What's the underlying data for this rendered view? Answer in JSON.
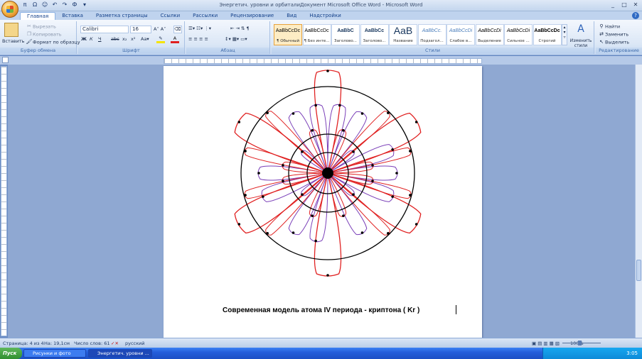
{
  "window": {
    "title": "Энергетич. уровни и орбиталиДокумент Microsoft Office Word - Microsoft Word",
    "qat": [
      "π",
      "Ω",
      "☺",
      "↶",
      "↷",
      "Ф",
      "▾"
    ]
  },
  "tabs": [
    "Главная",
    "Вставка",
    "Разметка страницы",
    "Ссылки",
    "Рассылки",
    "Рецензирование",
    "Вид",
    "Надстройки"
  ],
  "clipboard": {
    "paste": "Вставить",
    "cut": "Вырезать",
    "copy": "Копировать",
    "format": "Формат по образцу",
    "label": "Буфер обмена"
  },
  "font": {
    "name": "Calibri (Основной те",
    "size": "16",
    "label": "Шрифт"
  },
  "paragraph": {
    "label": "Абзац"
  },
  "styles": {
    "label": "Стили",
    "items": [
      {
        "sample": "AaBbCcDc",
        "name": "¶ Обычный"
      },
      {
        "sample": "AaBbCcDc",
        "name": "¶ Без инте..."
      },
      {
        "sample": "AaBbC",
        "name": "Заголово..."
      },
      {
        "sample": "AaBbCc",
        "name": "Заголово..."
      },
      {
        "sample": "AaB",
        "name": "Название"
      },
      {
        "sample": "AaBbCc.",
        "name": "Подзагол..."
      },
      {
        "sample": "AaBbCcDi",
        "name": "Слабое в..."
      },
      {
        "sample": "AaBbCcDi",
        "name": "Выделение"
      },
      {
        "sample": "AaBbCcDi",
        "name": "Сильное ..."
      },
      {
        "sample": "AaBbCcDc",
        "name": "Строгий"
      }
    ],
    "change": "Изменить стили"
  },
  "editing": {
    "find": "Найти",
    "replace": "Заменить",
    "select": "Выделить",
    "label": "Редактирование"
  },
  "document": {
    "caption": "Современная  модель атома IV периода  -  криптона  ( Kr )"
  },
  "status": {
    "page": "Страница: 4 из 4",
    "position": "На: 19,1см",
    "words": "Число слов: 61",
    "language": "русский",
    "zoom": "100%"
  },
  "taskbar": {
    "start": "Пуск",
    "tasks": [
      "Рисунки и фото",
      "Энергетич. уровни ..."
    ],
    "clock": "3:05"
  },
  "colors": {
    "orbit_red": "#e02020",
    "orbit_purple": "#7a3fb8",
    "shell": "#000000"
  }
}
